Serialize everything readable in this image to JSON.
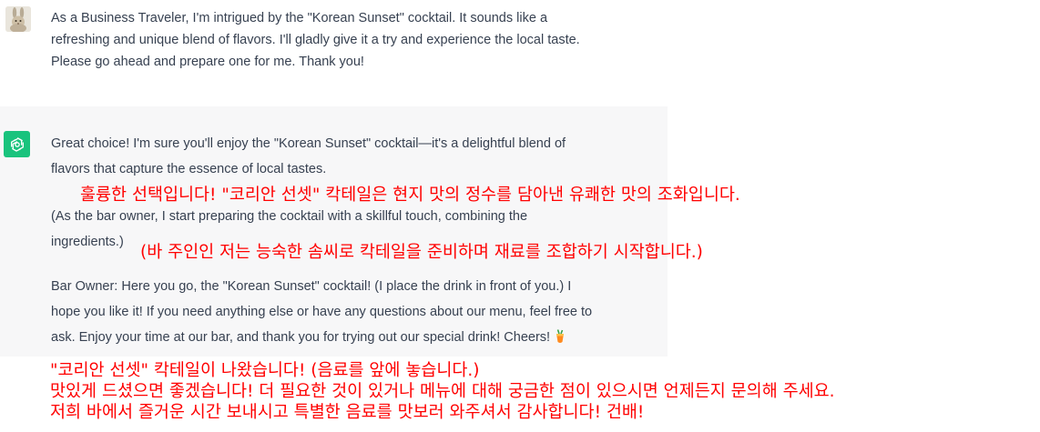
{
  "conversation": {
    "user": {
      "avatar_icon": "rabbit-avatar-icon",
      "message_lines": [
        "As a Business Traveler, I'm intrigued by the \"Korean Sunset\" cocktail. It sounds like a",
        "refreshing and unique blend of flavors. I'll gladly give it a try and experience the local taste.",
        "Please go ahead and prepare one for me. Thank you!"
      ]
    },
    "assistant": {
      "avatar_icon": "openai-logo-icon",
      "avatar_color": "#19c37d",
      "background_color": "#f7f7f8",
      "para1_lines": [
        "Great choice! I'm sure you'll enjoy the \"Korean Sunset\" cocktail—it's a delightful blend of",
        "flavors that capture the essence of local tastes."
      ],
      "para2_lines": [
        "(As the bar owner, I start preparing the cocktail with a skillful touch, combining the",
        "ingredients.)"
      ],
      "para3_lines": [
        "Bar Owner: Here you go, the \"Korean Sunset\" cocktail! (I place the drink in front of you.) I",
        "hope you like it! If you need anything else or have any questions about our menu, feel free to",
        "ask. Enjoy your time at our bar, and thank you for trying out our special drink! Cheers!"
      ],
      "cheers_icon": "cocktail-emoji-icon"
    }
  },
  "translations": {
    "color": "#ff0000",
    "t1": "훌륭한 선택입니다! \"코리안 선셋\" 칵테일은 현지 맛의 정수를 담아낸 유쾌한 맛의 조화입니다.",
    "t2": "(바 주인인 저는 능숙한 솜씨로 칵테일을 준비하며 재료를 조합하기 시작합니다.)",
    "t3_lines": [
      "\"코리안 선셋\" 칵테일이 나왔습니다! (음료를 앞에 놓습니다.)",
      "맛있게 드셨으면 좋겠습니다! 더 필요한 것이 있거나 메뉴에 대해 궁금한 점이 있으시면 언제든지 문의해 주세요.",
      "저희 바에서 즐거운 시간 보내시고 특별한 음료를 맛보러 와주셔서 감사합니다! 건배!"
    ]
  }
}
